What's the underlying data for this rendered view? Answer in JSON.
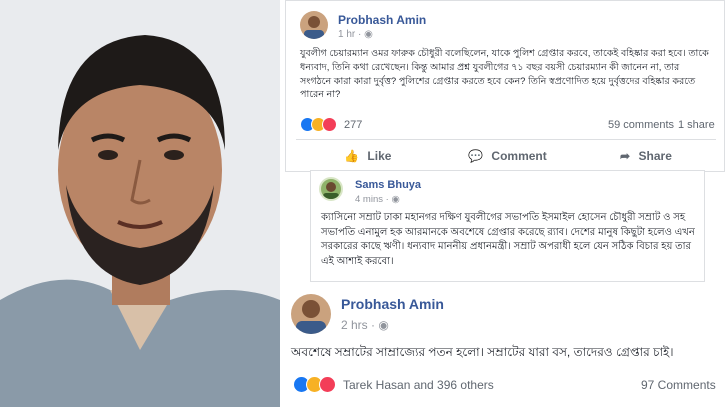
{
  "post1": {
    "author": "Probhash Amin",
    "time": "1 hr",
    "body": "যুবলীগ চেয়ারম্যান ওমর ফারুক চৌধুরী বলেছিলেন, যাকে পুলিশ গ্রেপ্তার করবে, তাকেই বহিষ্কার করা হবে। তাকে ধন্যবাদ, তিনি কথা রেখেছেন। কিন্তু আমার প্রশ্ন যুবলীগের ৭১ বছর বয়সী চেয়ারম্যান কী জানেন না, তার সংগঠনে কারা কারা দুর্বৃত্ত? পুলিশের গ্রেপ্তার করতে হবে কেন? তিনি স্বপ্রণোদিত হয়ে দুর্বৃত্তদের বহিষ্কার করতে পারেন না?",
    "reaction_count": "277",
    "comments": "59 comments",
    "shares": "1 share",
    "actions": {
      "like": "Like",
      "comment": "Comment",
      "share": "Share"
    }
  },
  "post2": {
    "author": "Sams Bhuya",
    "time": "4 mins",
    "body": "ক্যাসিনো সম্রাট ঢাকা মহানগর দক্ষিণ যুবলীগের সভাপতি ইসমাইল হোসেন চৌধুরী সম্রাট ও সহ সভাপতি এনামুল হক আরমানকে অবশেষে গ্রেপ্তার করেছে র‌্যাব। দেশের মানুষ কিছুটা হলেও এখন সরকারের কাছে ঋণী। ধন্যবাদ মাননীয় প্রধানমন্ত্রী। সম্রাট অপরাধী হলে যেন সঠিক বিচার হয় তার এই আশাই করবো।"
  },
  "post3": {
    "author": "Probhash Amin",
    "time": "2 hrs",
    "body": "অবশেষে সম্রাটের সাম্রাজ্যের পতন হলো। সম্রাটের যারা বস, তাদেরও গ্রেপ্তার চাই।",
    "reactors": "Tarek Hasan and 396 others",
    "comments": "97 Comments"
  },
  "colors": {
    "link": "#385898",
    "like_blue": "#1877f2",
    "love_red": "#f33e58",
    "haha_yellow": "#f7b125"
  }
}
